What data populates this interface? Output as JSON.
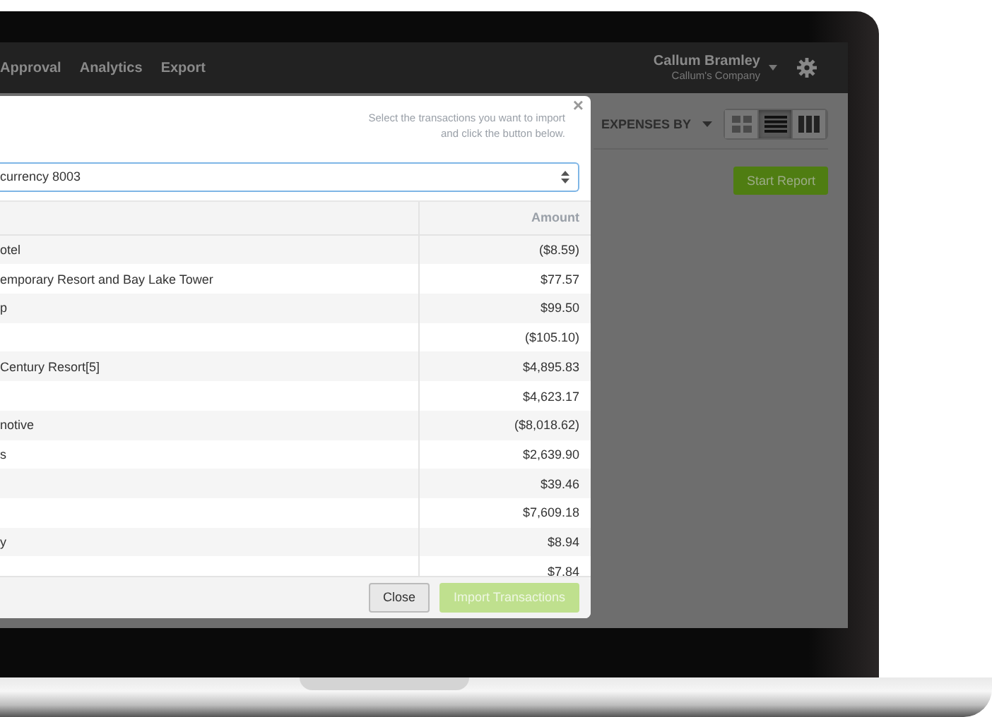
{
  "nav": {
    "items": [
      "Approval",
      "Analytics",
      "Export"
    ],
    "user_name": "Callum Bramley",
    "company": "Callum's Company"
  },
  "toolbar": {
    "group_label": "EXPENSES BY",
    "views": [
      {
        "kind": "grid",
        "selected": false
      },
      {
        "kind": "list",
        "selected": true
      },
      {
        "kind": "columns",
        "selected": false
      }
    ],
    "start_button": "Start Report"
  },
  "modal": {
    "close": "×",
    "instructions": [
      "Select the transactions you want to import",
      "and click the button below."
    ],
    "account": "currency 8003",
    "columns": [
      "Amount"
    ],
    "rows": [
      {
        "name": "otel",
        "amount": "($8.59)"
      },
      {
        "name": "emporary Resort and Bay Lake Tower",
        "amount": "$77.57"
      },
      {
        "name": "p",
        "amount": "$99.50"
      },
      {
        "amount": "($105.10)"
      },
      {
        "name": "Century Resort[5]",
        "amount": "$4,895.83"
      },
      {
        "amount": "$4,623.17"
      },
      {
        "name": "notive",
        "amount": "($8,018.62)"
      },
      {
        "name": "s",
        "amount": "$2,639.90"
      },
      {
        "amount": "$39.46"
      },
      {
        "amount": "$7,609.18"
      },
      {
        "name": "y",
        "amount": "$8.94"
      },
      {
        "amount": "$7.84"
      }
    ],
    "buttons": [
      {
        "label": "Close",
        "kind": "secondary",
        "disabled": false
      },
      {
        "label": "Import Transactions",
        "kind": "primary",
        "disabled": true
      }
    ]
  }
}
